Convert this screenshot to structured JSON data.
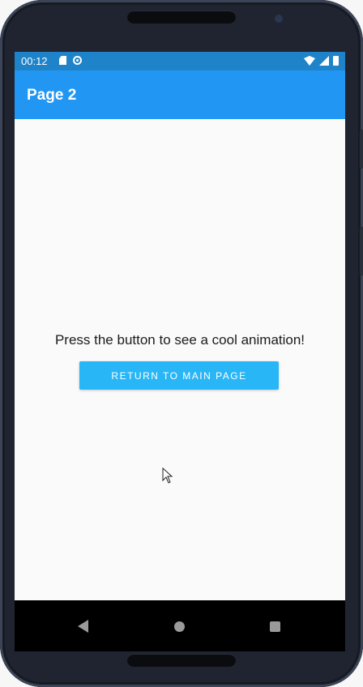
{
  "status_bar": {
    "time": "00:12",
    "left_icons": [
      "sd-card-icon",
      "at-sign-icon"
    ],
    "right_icons": [
      "wifi-icon",
      "signal-icon",
      "battery-icon"
    ],
    "color": "#1f83c9"
  },
  "app_bar": {
    "title": "Page 2",
    "color": "#2196f3"
  },
  "main": {
    "message": "Press the button to see a cool animation!",
    "return_button_label": "RETURN TO MAIN PAGE",
    "button_color": "#29b6f6"
  },
  "nav_bar": {
    "buttons": [
      "back-icon",
      "home-icon",
      "recents-icon"
    ]
  }
}
